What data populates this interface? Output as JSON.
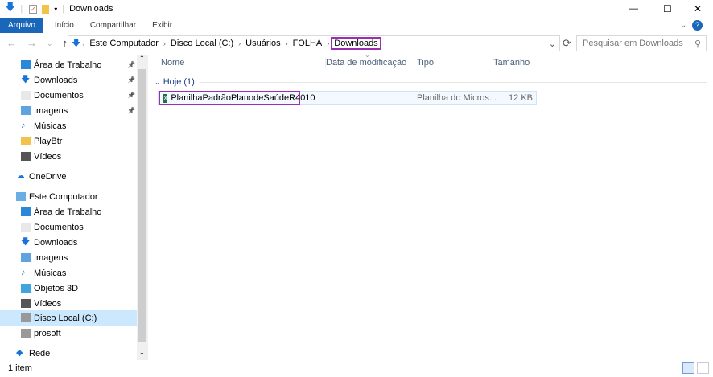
{
  "window": {
    "title": "Downloads",
    "controls": [
      "—",
      "☐",
      "✕"
    ]
  },
  "ribbon": {
    "tabs": [
      "Arquivo",
      "Início",
      "Compartilhar",
      "Exibir"
    ]
  },
  "nav": {
    "path": [
      "Este Computador",
      "Disco Local (C:)",
      "Usuários",
      "FOLHA",
      "Downloads"
    ],
    "search_placeholder": "Pesquisar em Downloads"
  },
  "sidebar": {
    "items": [
      {
        "label": "Área de Trabalho",
        "icon": "desktop-icon",
        "pinned": true
      },
      {
        "label": "Downloads",
        "icon": "download-icon",
        "pinned": true
      },
      {
        "label": "Documentos",
        "icon": "documents-icon",
        "pinned": true
      },
      {
        "label": "Imagens",
        "icon": "pictures-icon",
        "pinned": true
      },
      {
        "label": "Músicas",
        "icon": "music-icon"
      },
      {
        "label": "PlayBtr",
        "icon": "folder-icon"
      },
      {
        "label": "Vídeos",
        "icon": "videos-icon"
      },
      {
        "label": "OneDrive",
        "icon": "cloud-icon",
        "root": true
      },
      {
        "label": "Este Computador",
        "icon": "computer-icon",
        "root": true
      },
      {
        "label": "Área de Trabalho",
        "icon": "desktop-icon"
      },
      {
        "label": "Documentos",
        "icon": "documents-icon"
      },
      {
        "label": "Downloads",
        "icon": "download-icon"
      },
      {
        "label": "Imagens",
        "icon": "pictures-icon"
      },
      {
        "label": "Músicas",
        "icon": "music-icon"
      },
      {
        "label": "Objetos 3D",
        "icon": "cube-icon"
      },
      {
        "label": "Vídeos",
        "icon": "videos-icon"
      },
      {
        "label": "Disco Local (C:)",
        "icon": "drive-icon",
        "selected": true
      },
      {
        "label": "prosoft",
        "icon": "drive-icon"
      },
      {
        "label": "Rede",
        "icon": "network-icon",
        "root": true
      }
    ]
  },
  "columns": [
    "Nome",
    "Data de modificação",
    "Tipo",
    "Tamanho"
  ],
  "group": "Hoje (1)",
  "files": [
    {
      "name": "PlanilhaPadrãoPlanodeSaúdeR4010",
      "date": "",
      "type": "Planilha do Micros...",
      "size": "12 KB"
    }
  ],
  "status": {
    "count": "1 item"
  },
  "colors": {
    "accent": "#1a66b8",
    "highlight": "#9b2fae"
  }
}
